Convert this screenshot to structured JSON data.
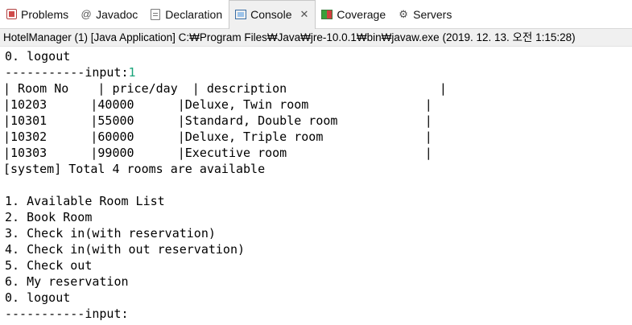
{
  "tabs": [
    {
      "label": "Problems",
      "icon": "problems-icon"
    },
    {
      "label": "Javadoc",
      "icon": "at-sign-icon",
      "icon_glyph": "@"
    },
    {
      "label": "Declaration",
      "icon": "declaration-icon"
    },
    {
      "label": "Console",
      "icon": "console-icon",
      "active": true,
      "close_glyph": "✕"
    },
    {
      "label": "Coverage",
      "icon": "coverage-icon"
    },
    {
      "label": "Servers",
      "icon": "servers-icon",
      "icon_glyph": "⚙"
    }
  ],
  "console_title": "HotelManager (1) [Java Application] C:₩Program Files₩Java₩jre-10.0.1₩bin₩javaw.exe (2019. 12. 13. 오전 1:15:28)",
  "console": {
    "line0": "0. logout",
    "input_prompt": "-----------input:",
    "input_value": "1",
    "table_header": "| Room No    | price/day  | description                     |",
    "rows": [
      "|10203      |40000      |Deluxe, Twin room                |",
      "|10301      |55000      |Standard, Double room            |",
      "|10302      |60000      |Deluxe, Triple room              |",
      "|10303      |99000      |Executive room                   |"
    ],
    "system_msg": "[system] Total 4 rooms are available",
    "menu": [
      "1. Available Room List",
      "2. Book Room",
      "3. Check in(with reservation)",
      "4. Check in(with out reservation)",
      "5. Check out",
      "6. My reservation",
      "0. logout"
    ],
    "final_prompt": "-----------input:"
  },
  "colors": {
    "input_value": "#1aa47a",
    "tab_active_bg": "#f0f0f0"
  }
}
